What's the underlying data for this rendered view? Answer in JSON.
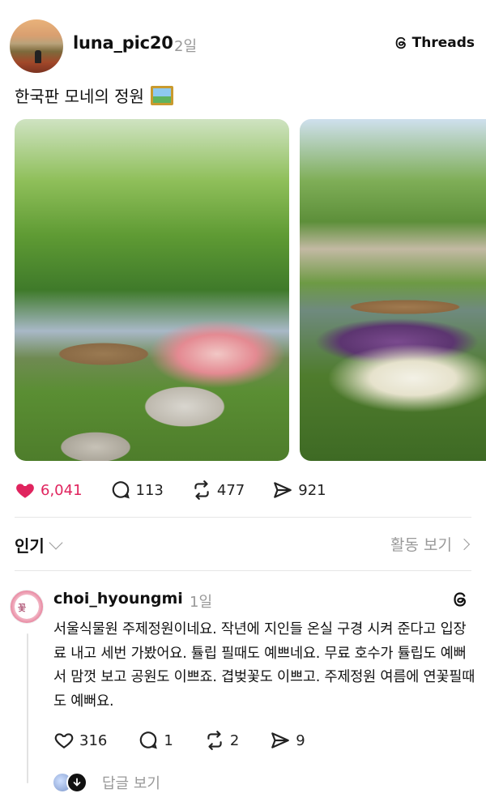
{
  "post": {
    "username": "luna_pic20",
    "time": "2일",
    "threads_label": "Threads",
    "caption": "한국판 모네의 정원",
    "images": [
      "photo-tulip-garden-boat-1",
      "photo-tulip-garden-boat-2"
    ],
    "likes": "6,041",
    "comments": "113",
    "reposts": "477",
    "shares": "921"
  },
  "sort": {
    "label": "인기",
    "activity_link": "활동 보기"
  },
  "comment": {
    "username": "choi_hyoungmi",
    "time": "1일",
    "text": "서울식물원 주제정원이네요. 작년에 지인들 온실 구경 시켜 준다고 입장료 내고 세번 가봤어요. 튤립 필때도 예쁘네요. 무료 호수가 튤립도 예뻐서 맘껏 보고 공원도 이쁘죠. 겹벚꽃도 이쁘고. 주제정원 여름에 연꽃필때도 예뻐요.",
    "likes": "316",
    "comments": "1",
    "reposts": "2",
    "shares": "9",
    "replies_label": "답글 보기"
  },
  "colors": {
    "like_red": "#e0245e",
    "muted": "#999999",
    "divider": "#e6e6e6"
  },
  "icons": [
    "threads-icon",
    "heart-icon",
    "comment-icon",
    "repost-icon",
    "share-icon",
    "chevron-down-icon",
    "chevron-right-icon"
  ]
}
